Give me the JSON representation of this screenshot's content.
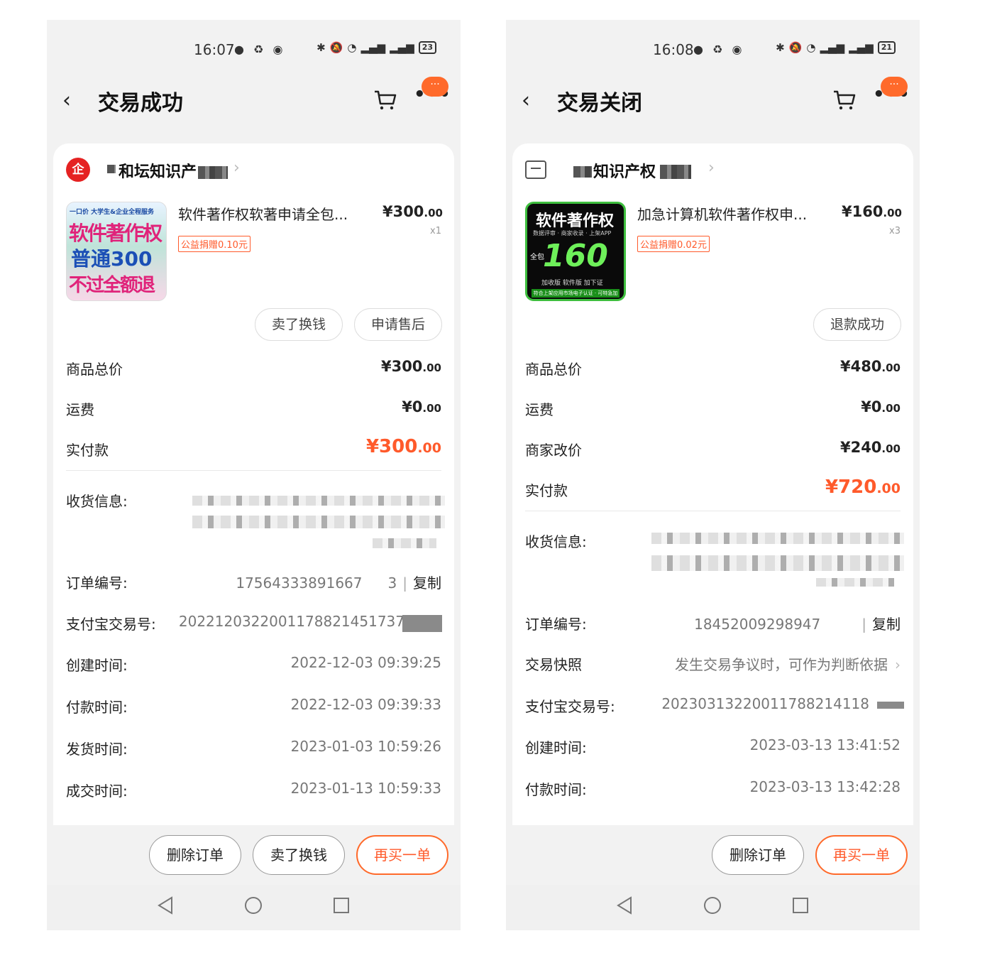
{
  "left": {
    "status": {
      "time": "16:07",
      "battery": "23"
    },
    "title": "交易成功",
    "shop_name": "和坛知识产",
    "product": {
      "title": "软件著作权软著申请全包...",
      "price_int": "¥300",
      "price_dec": ".00",
      "qty": "x1",
      "charity": "公益捐赠0.10元",
      "image_text": {
        "l1": "一口价 大学生&企业全程服务",
        "l2": "软件著作权",
        "l3": "普通300",
        "l4": "不过全额退"
      }
    },
    "item_buttons": [
      "卖了换钱",
      "申请售后"
    ],
    "totals": [
      {
        "label": "商品总价",
        "int": "¥300",
        "dec": ".00"
      },
      {
        "label": "运费",
        "int": "¥0",
        "dec": ".00"
      }
    ],
    "paid": {
      "label": "实付款",
      "int": "¥300",
      "dec": ".00"
    },
    "info": {
      "address_label": "收货信息:",
      "order_label": "订单编号:",
      "order_value": "17564333891667",
      "order_tail": "3",
      "copy": "复制",
      "alipay_label": "支付宝交易号:",
      "alipay_value": "2022120322001178821451737",
      "rows": [
        {
          "label": "创建时间:",
          "value": "2022-12-03 09:39:25"
        },
        {
          "label": "付款时间:",
          "value": "2022-12-03 09:39:33"
        },
        {
          "label": "发货时间:",
          "value": "2023-01-03 10:59:26"
        },
        {
          "label": "成交时间:",
          "value": "2023-01-13 10:59:33"
        }
      ]
    },
    "actions": [
      "删除订单",
      "卖了换钱",
      "再买一单"
    ]
  },
  "right": {
    "status": {
      "time": "16:08",
      "battery": "21"
    },
    "title": "交易关闭",
    "shop_name": "知识产权",
    "product": {
      "title": "加急计算机软件著作权申...",
      "price_int": "¥160",
      "price_dec": ".00",
      "qty": "x3",
      "charity": "公益捐赠0.02元",
      "image_text": {
        "l1": "软件著作权",
        "l2": "数据评审 · 商家收录 · 上架APP",
        "l3": "160",
        "l3s": "全包",
        "l4": "加收版 软件版 加下证",
        "l5": "符合上架应用市场电子认证 · 可特急加急!"
      }
    },
    "item_buttons": [
      "退款成功"
    ],
    "totals": [
      {
        "label": "商品总价",
        "int": "¥480",
        "dec": ".00"
      },
      {
        "label": "运费",
        "int": "¥0",
        "dec": ".00"
      },
      {
        "label": "商家改价",
        "int": "¥240",
        "dec": ".00"
      }
    ],
    "paid": {
      "label": "实付款",
      "int": "¥720",
      "dec": ".00"
    },
    "info": {
      "address_label": "收货信息:",
      "order_label": "订单编号:",
      "order_value": "18452009298947",
      "copy": "复制",
      "snapshot_label": "交易快照",
      "snapshot_value": "发生交易争议时，可作为判断依据",
      "alipay_label": "支付宝交易号:",
      "alipay_value": "20230313220011788214118",
      "rows": [
        {
          "label": "创建时间:",
          "value": "2023-03-13 13:41:52"
        },
        {
          "label": "付款时间:",
          "value": "2023-03-13 13:42:28"
        }
      ]
    },
    "actions": [
      "删除订单",
      "再买一单"
    ]
  },
  "colors": {
    "accent": "#ff5a2b",
    "badge": "#ff6a2b",
    "bg": "#f2f2f2"
  },
  "icons": [
    "back-icon",
    "cart-icon",
    "more-icon",
    "shop-icon",
    "nav-back-icon",
    "nav-home-icon",
    "nav-recent-icon"
  ]
}
